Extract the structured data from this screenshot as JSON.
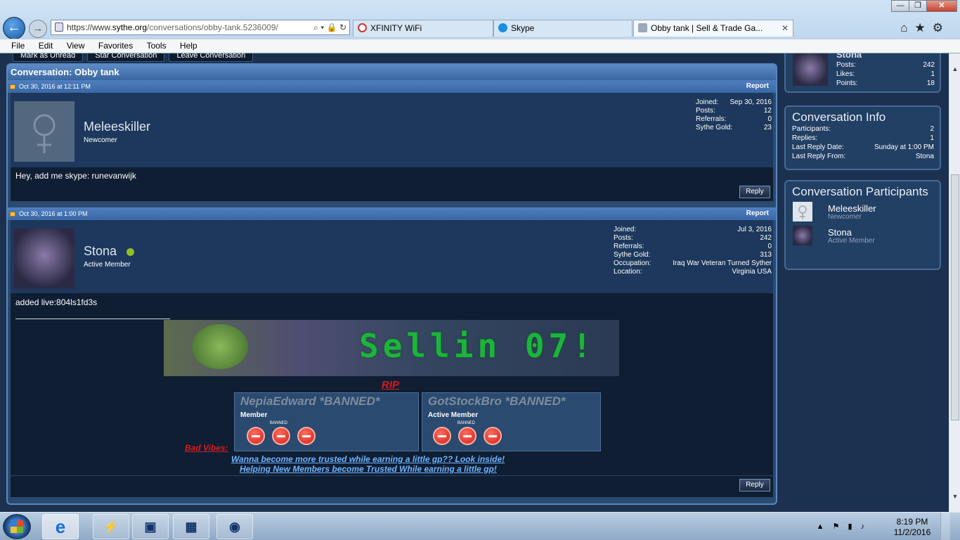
{
  "browser": {
    "url_prefix": "https://www.",
    "url_host": "sythe.org",
    "url_path": "/conversations/obby-tank.5236009/",
    "tabs": [
      {
        "label": "XFINITY WiFi",
        "active": false
      },
      {
        "label": "Skype",
        "active": false
      },
      {
        "label": "Obby tank | Sell & Trade Ga...",
        "active": true
      }
    ],
    "menu": [
      "File",
      "Edit",
      "View",
      "Favorites",
      "Tools",
      "Help"
    ]
  },
  "page": {
    "top_buttons": [
      "Mark as Unread",
      "Star Conversation",
      "Leave Conversation"
    ],
    "conversation_title": "Conversation: Obby tank",
    "messages": [
      {
        "date": "Oct 30, 2016 at 12:11 PM",
        "report": "Report",
        "username": "Meleeskiller",
        "rank": "Newcomer",
        "stats": [
          {
            "k": "Joined:",
            "v": "Sep 30, 2016"
          },
          {
            "k": "Posts:",
            "v": "12"
          },
          {
            "k": "Referrals:",
            "v": "0"
          },
          {
            "k": "Sythe Gold:",
            "v": "23"
          }
        ],
        "body": "Hey, add me skype: runevanwijk",
        "reply": "Reply"
      },
      {
        "date": "Oct 30, 2016 at 1:00 PM",
        "report": "Report",
        "username": "Stona",
        "rank": "Active Member",
        "stats": [
          {
            "k": "Joined:",
            "v": "Jul 3, 2016"
          },
          {
            "k": "Posts:",
            "v": "242"
          },
          {
            "k": "Referrals:",
            "v": "0"
          },
          {
            "k": "Sythe Gold:",
            "v": "313"
          },
          {
            "k": "Occupation:",
            "v": "Iraq War Veteran Turned Syther"
          },
          {
            "k": "Location:",
            "v": "Virginia USA"
          }
        ],
        "body": "added live:804ls1fd3s",
        "reply": "Reply"
      }
    ],
    "signature": {
      "banner_text": "Sellin 07!",
      "rip": "RIP",
      "banned": [
        {
          "name": "NepiaEdward *BANNED*",
          "rank": "Member",
          "badge": "BANNED"
        },
        {
          "name": "GotStockBro *BANNED*",
          "rank": "Active Member",
          "badge": "BANNED"
        }
      ],
      "bad_vibes": "Bad Vibes:",
      "promo1": "Wanna become more trusted while earning a little gp?? Look inside!",
      "promo2": "Helping New Members become Trusted While earning a little gp!"
    }
  },
  "sidebar": {
    "user": {
      "name": "Stona",
      "stats": [
        {
          "k": "Posts:",
          "v": "242"
        },
        {
          "k": "Likes:",
          "v": "1"
        },
        {
          "k": "Points:",
          "v": "18"
        }
      ]
    },
    "info": {
      "title": "Conversation Info",
      "rows": [
        {
          "k": "Participants:",
          "v": "2"
        },
        {
          "k": "Replies:",
          "v": "1"
        },
        {
          "k": "Last Reply Date:",
          "v": "Sunday at 1:00 PM"
        },
        {
          "k": "Last Reply From:",
          "v": "Stona"
        }
      ]
    },
    "participants": {
      "title": "Conversation Participants",
      "list": [
        {
          "name": "Meleeskiller",
          "rank": "Newcomer"
        },
        {
          "name": "Stona",
          "rank": "Active Member"
        }
      ]
    }
  },
  "taskbar": {
    "time": "8:19 PM",
    "date": "11/2/2016"
  },
  "colors": {
    "accent": "#5a86c0",
    "online": "#8fbf2a",
    "banner_green": "#1db43c",
    "rip_red": "#d81a1a",
    "promo_blue": "#6fb4ff"
  }
}
